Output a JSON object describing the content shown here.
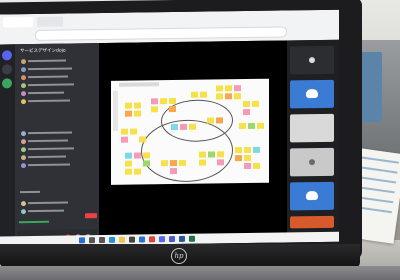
{
  "sidebar": {
    "server_name": "サービスデザインdojo"
  },
  "colors": {
    "discord_blurple": "#5865f2",
    "sidebar_bg": "#2f3136",
    "rail_bg": "#202225",
    "live_red": "#ed4245",
    "voice_green": "#3ba55d",
    "sticky_yellow": "#f7e14a",
    "sticky_pink": "#f59bb8",
    "sticky_cyan": "#7fd8e8",
    "sticky_green": "#9fd86a",
    "sticky_orange": "#f6a84b"
  },
  "icons": {
    "server_rail": [
      "discord-logo-icon",
      "server-icon",
      "add-server-icon"
    ],
    "voice_controls": [
      "mute-mic-icon",
      "deafen-headphones-icon",
      "settings-gear-icon"
    ],
    "taskbar": [
      "start-icon",
      "search-icon",
      "taskview-icon",
      "edge-icon",
      "explorer-icon",
      "store-icon",
      "mail-icon",
      "chrome-icon",
      "discord-icon",
      "teams-icon",
      "word-icon",
      "excel-icon"
    ]
  },
  "participants": {
    "count": 5
  }
}
